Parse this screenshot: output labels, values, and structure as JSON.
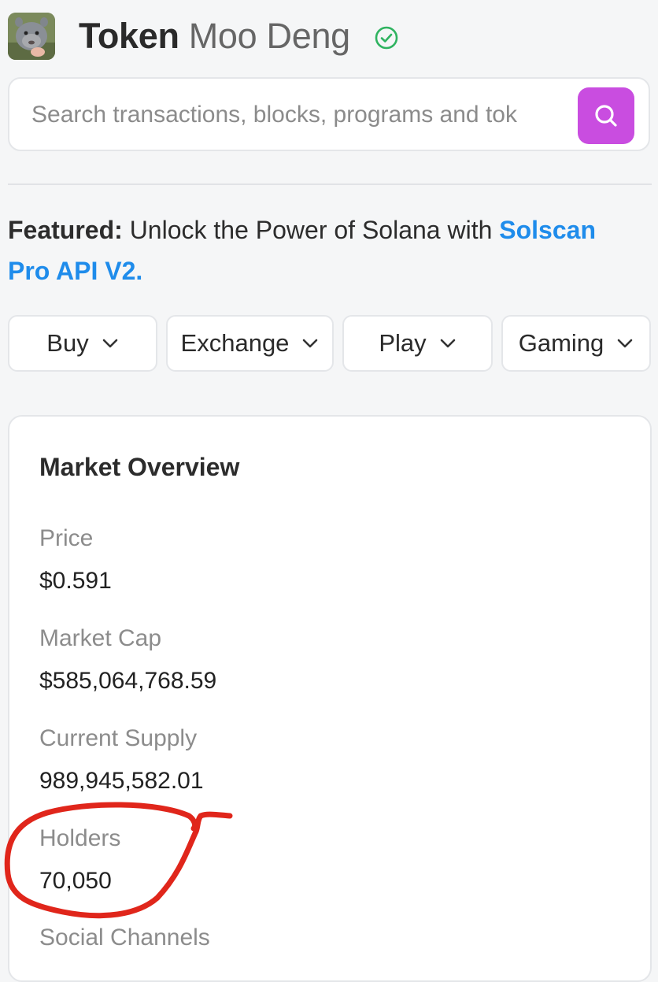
{
  "header": {
    "title_kind": "Token",
    "title_name": "Moo Deng",
    "verified_icon": "check-circle-icon",
    "verified_color": "#2fb360"
  },
  "search": {
    "placeholder": "Search transactions, blocks, programs and tok",
    "button_icon": "search-icon",
    "button_color": "#c94de0"
  },
  "featured": {
    "label": "Featured:",
    "text": " Unlock the Power of Solana with ",
    "link": "Solscan Pro API V2."
  },
  "menu": [
    {
      "label": "Buy"
    },
    {
      "label": "Exchange"
    },
    {
      "label": "Play"
    },
    {
      "label": "Gaming"
    }
  ],
  "market_overview": {
    "title": "Market Overview",
    "stats": [
      {
        "label": "Price",
        "value": "$0.591"
      },
      {
        "label": "Market Cap",
        "value": "$585,064,768.59"
      },
      {
        "label": "Current Supply",
        "value": "989,945,582.01"
      },
      {
        "label": "Holders",
        "value": "70,050"
      },
      {
        "label": "Social Channels",
        "value": ""
      }
    ]
  },
  "annotation": {
    "color": "#e0261b",
    "highlights": "Holders"
  }
}
